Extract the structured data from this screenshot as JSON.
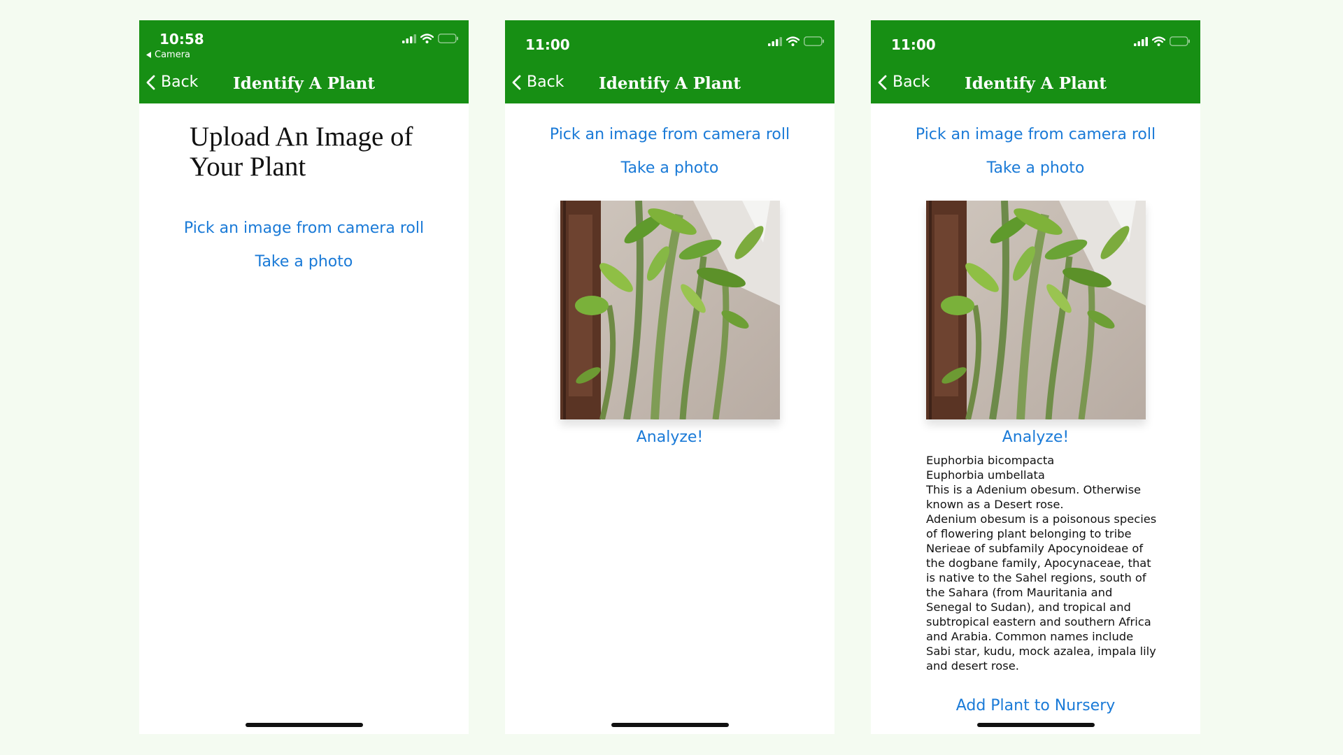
{
  "nav": {
    "back_label": "Back",
    "title": "Identify A Plant"
  },
  "screen1": {
    "status_time": "10:58",
    "status_app_return": "Camera",
    "heading": "Upload An Image of Your Plant",
    "pick_image_label": "Pick an image from camera roll",
    "take_photo_label": "Take a photo"
  },
  "screen2": {
    "status_time": "11:00",
    "pick_image_label": "Pick an image from camera roll",
    "take_photo_label": "Take a photo",
    "analyze_label": "Analyze!"
  },
  "screen3": {
    "status_time": "11:00",
    "pick_image_label": "Pick an image from camera roll",
    "take_photo_label": "Take a photo",
    "analyze_label": "Analyze!",
    "result_lines": [
      "Euphorbia bicompacta",
      "Euphorbia umbellata",
      "This is a Adenium obesum. Otherwise known as a Desert rose.",
      "Adenium obesum is a poisonous species of flowering plant belonging to tribe Nerieae of subfamily Apocynoideae of the dogbane family, Apocynaceae, that is native to the Sahel regions, south of the Sahara (from Mauritania and Senegal to Sudan), and tropical and subtropical eastern and southern Africa and Arabia. Common names include Sabi star, kudu, mock azalea, impala lily and desert rose."
    ],
    "add_nursery_label": "Add Plant to Nursery"
  },
  "colors": {
    "header_green": "#178f14",
    "link_blue": "#1a7ad7",
    "page_background": "#f4fbf1"
  },
  "icons": {
    "signal": "signal-icon",
    "wifi": "wifi-icon",
    "battery": "battery-icon",
    "back": "chevron-left-icon",
    "return_arrow": "triangle-left-icon"
  }
}
